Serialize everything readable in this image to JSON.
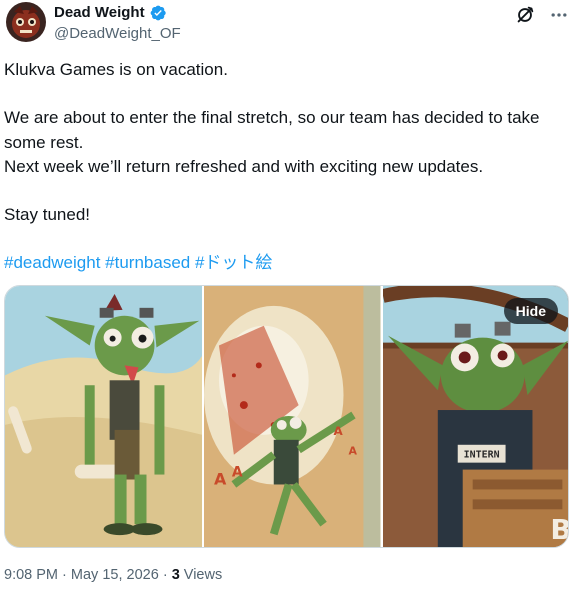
{
  "author": {
    "display_name": "Dead Weight",
    "handle": "@DeadWeight_OF",
    "verified": true,
    "avatar_icon": "avatar-character"
  },
  "actions": {
    "grok_icon": "grok-icon",
    "more_icon": "more-icon"
  },
  "tweet": {
    "line1": "Klukva Games is on vacation.",
    "line2": "We are about to enter the final stretch, so our team has decided to take some rest.",
    "line3": "Next week we’ll return refreshed and with exciting new updates.",
    "line4": "Stay tuned!",
    "hashtags": [
      "#deadweight",
      "#turnbased",
      "#ドット絵"
    ]
  },
  "media": {
    "hide_label": "Hide",
    "panel3_sign": "INTERN"
  },
  "meta": {
    "time": "9:08 PM",
    "sep1": "·",
    "date": "May 15, 2026",
    "sep2": "·",
    "views_count": "3",
    "views_label": "Views"
  },
  "colors": {
    "link": "#1d9bf0",
    "secondary": "#536471",
    "verified": "#1d9bf0"
  }
}
